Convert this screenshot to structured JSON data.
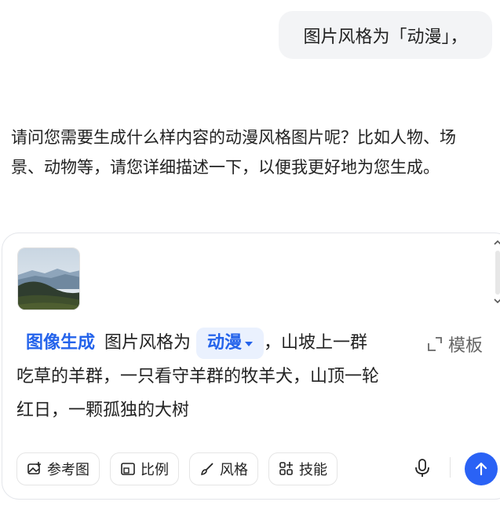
{
  "user_message": {
    "text": "图片风格为「动漫」，"
  },
  "assistant_message": {
    "lines": [
      "请问您需要生成什么样内容的动漫风格图片呢？比如人物、场",
      "景、动物等，请您详细描述一下，以便我更好地为您生成。"
    ]
  },
  "composer": {
    "attachment": {
      "icon": "landscape-photo-thumbnail"
    },
    "mode_tag": "图像生成",
    "prompt_prefix": "图片风格为",
    "style_chip": {
      "label": "动漫"
    },
    "prompt_line1_suffix": "，山坡上一群",
    "prompt_line2": "吃草的羊群，一只看守羊群的牧羊犬，山顶一轮",
    "prompt_line3": "红日，一颗孤独的大树",
    "template_label": "模板",
    "toolbar": {
      "reference_image": "参考图",
      "ratio": "比例",
      "style": "风格",
      "skills": "技能"
    },
    "send_color": "#2a62f5",
    "accent_color": "#2463eb"
  }
}
